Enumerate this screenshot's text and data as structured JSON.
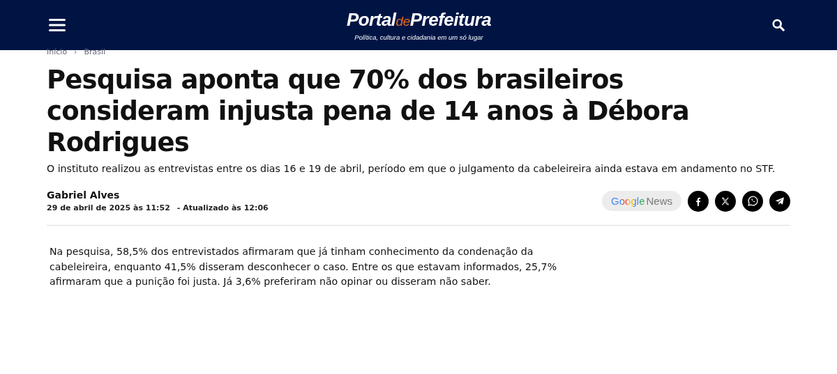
{
  "header": {
    "logo": {
      "part_1": "Portal",
      "part_2": "de",
      "part_3": "Prefeitura"
    },
    "tagline": "Política, cultura e cidadania em um só lugar"
  },
  "breadcrumb": [
    {
      "label": "Início"
    },
    {
      "label": "Brasil"
    }
  ],
  "breadcrumb_separator": "›",
  "article": {
    "title": "Pesquisa aponta que 70% dos brasileiros consideram injusta pena de 14 anos à Débora Rodrigues",
    "subtitle": "O instituto realizou as entrevistas entre os dias 16 e 19 de abril, período em que o julgamento da cabeleireira ainda estava em andamento no STF.",
    "author": "Gabriel Alves",
    "published": "29 de abril de 2025 às 11:52",
    "updated": "- Atualizado às 12:06",
    "google_news": {
      "part_1": "Google",
      "part_2": "News"
    },
    "share": [
      {
        "kind": "facebook"
      },
      {
        "kind": "x"
      },
      {
        "kind": "whatsapp"
      },
      {
        "kind": "telegram"
      }
    ],
    "body": "Na pesquisa, 58,5% dos entrevistados afirmaram que já tinham conhecimento da condenação da cabeleireira, enquanto 41,5% disseram desconhecer o caso. Entre os que estavam informados, 25,7% afirmaram que a punição foi justa. Já 3,6% preferiram não opinar ou disseram não saber."
  }
}
